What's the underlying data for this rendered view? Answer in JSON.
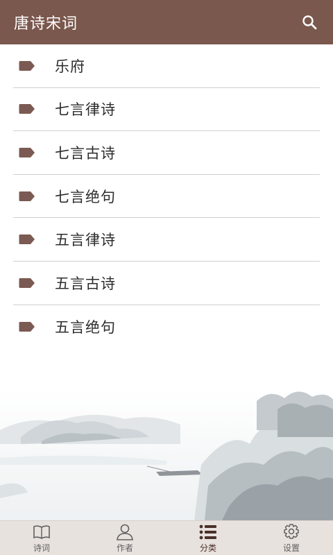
{
  "app": {
    "title": "唐诗宋词",
    "search_icon": "search-icon",
    "accent": "#7a584d"
  },
  "categories": [
    {
      "label": "乐府"
    },
    {
      "label": "七言律诗"
    },
    {
      "label": "七言古诗"
    },
    {
      "label": "七言绝句"
    },
    {
      "label": "五言律诗"
    },
    {
      "label": "五言古诗"
    },
    {
      "label": "五言绝句"
    }
  ],
  "tabs": [
    {
      "label": "诗词",
      "icon": "book-icon",
      "active": false
    },
    {
      "label": "作者",
      "icon": "person-icon",
      "active": false
    },
    {
      "label": "分类",
      "icon": "list-icon",
      "active": true
    },
    {
      "label": "设置",
      "icon": "gear-icon",
      "active": false
    }
  ]
}
